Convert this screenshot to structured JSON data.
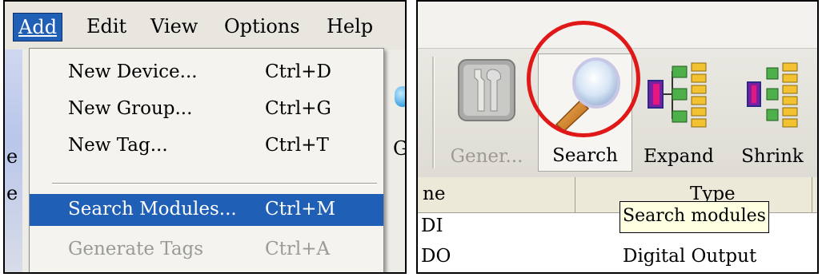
{
  "left": {
    "menubar": {
      "items": [
        {
          "label": "Add",
          "active": true
        },
        {
          "label": "Edit",
          "active": false
        },
        {
          "label": "View",
          "active": false
        },
        {
          "label": "Options",
          "active": false
        },
        {
          "label": "Help",
          "active": false
        }
      ]
    },
    "background_letters": [
      "e",
      "G",
      "e"
    ],
    "add_menu": {
      "items": [
        {
          "label": "New Device...",
          "shortcut": "Ctrl+D",
          "state": "normal"
        },
        {
          "label": "New Group...",
          "shortcut": "Ctrl+G",
          "state": "normal"
        },
        {
          "label": "New Tag...",
          "shortcut": "Ctrl+T",
          "state": "normal"
        },
        {
          "label": "Search Modules...",
          "shortcut": "Ctrl+M",
          "state": "selected"
        },
        {
          "label": "Generate Tags",
          "shortcut": "Ctrl+A",
          "state": "disabled"
        }
      ]
    }
  },
  "right": {
    "toolbar": {
      "buttons": [
        {
          "label": "Gener...",
          "icon": "wrench-screwdriver-icon",
          "enabled": false
        },
        {
          "label": "Search",
          "icon": "magnifier-icon",
          "enabled": true,
          "highlighted": true
        },
        {
          "label": "Expand",
          "icon": "tree-expand-icon",
          "enabled": true
        },
        {
          "label": "Shrink",
          "icon": "tree-shrink-icon",
          "enabled": true
        }
      ]
    },
    "grid": {
      "columns": [
        "ne",
        "Type"
      ],
      "rows": [
        {
          "name": "DI",
          "type": ""
        },
        {
          "name": "DO",
          "type": "Digital Output"
        }
      ]
    },
    "tooltip": "Search modules",
    "colors": {
      "highlight_circle": "#e01818",
      "menu_selection": "#1f5fb5"
    }
  }
}
